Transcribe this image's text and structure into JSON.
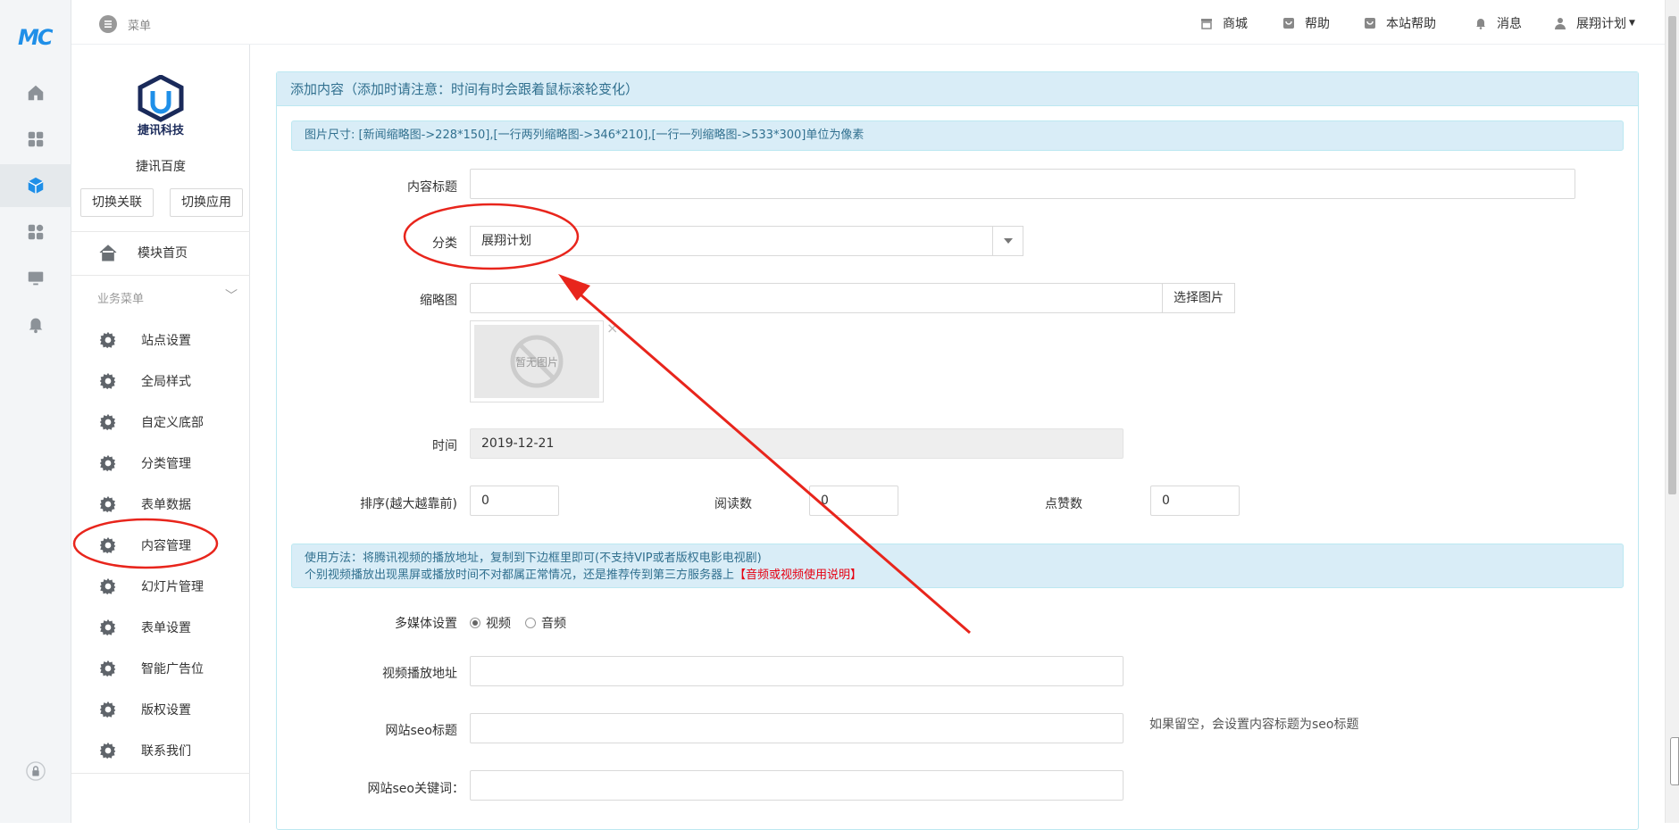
{
  "rail": {
    "logo": "MC",
    "items": [
      "home-icon",
      "apps-grid-icon",
      "cube-icon",
      "modules-icon",
      "monitor-icon",
      "bell-icon"
    ],
    "bottom": "lock-icon"
  },
  "sidebar": {
    "logo_text": "捷讯科技",
    "site_name": "捷讯百度",
    "switch_link": "切换关联",
    "switch_app": "切换应用",
    "home": "模块首页",
    "section": "业务菜单",
    "items": [
      "站点设置",
      "全局样式",
      "自定义底部",
      "分类管理",
      "表单数据",
      "内容管理",
      "幻灯片管理",
      "表单设置",
      "智能广告位",
      "版权设置",
      "联系我们"
    ]
  },
  "header": {
    "menu": "菜单",
    "links": {
      "shop": "商城",
      "help": "帮助",
      "site_help": "本站帮助",
      "messages": "消息",
      "user": "展翔计划"
    }
  },
  "panel": {
    "title": "添加内容（添加时请注意：时间有时会跟着鼠标滚轮变化）",
    "image_size_note": "图片尺寸: [新闻缩略图->228*150],[一行两列缩略图->346*210],[一行一列缩略图->533*300]单位为像素",
    "fields": {
      "title_label": "内容标题",
      "title_value": "",
      "category_label": "分类",
      "category_value": "展翔计划",
      "thumb_label": "缩略图",
      "thumb_value": "",
      "pick_image": "选择图片",
      "no_image": "暂无图片",
      "close": "×",
      "time_label": "时间",
      "time_value": "2019-12-21",
      "sort_label": "排序(越大越靠前)",
      "sort_value": "0",
      "reads_label": "阅读数",
      "reads_value": "0",
      "likes_label": "点赞数",
      "likes_value": "0"
    },
    "video_note_line1": "使用方法：将腾讯视频的播放地址，复制到下边框里即可(不支持VIP或者版权电影电视剧)",
    "video_note_line2": "个别视频播放出现黑屏或播放时间不对都属正常情况，还是推荐传到第三方服务器上",
    "video_note_link": "【音频或视频使用说明】",
    "media": {
      "label": "多媒体设置",
      "video": "视频",
      "audio": "音频",
      "video_url_label": "视频播放地址",
      "seo_title_label": "网站seo标题",
      "seo_title_hint": "如果留空，会设置内容标题为seo标题",
      "seo_keywords_label": "网站seo关键词："
    }
  },
  "colors": {
    "accent": "#1f8fe8",
    "info_bg": "#d9edf7",
    "info_text": "#31708f",
    "annotation": "#e8251c"
  }
}
